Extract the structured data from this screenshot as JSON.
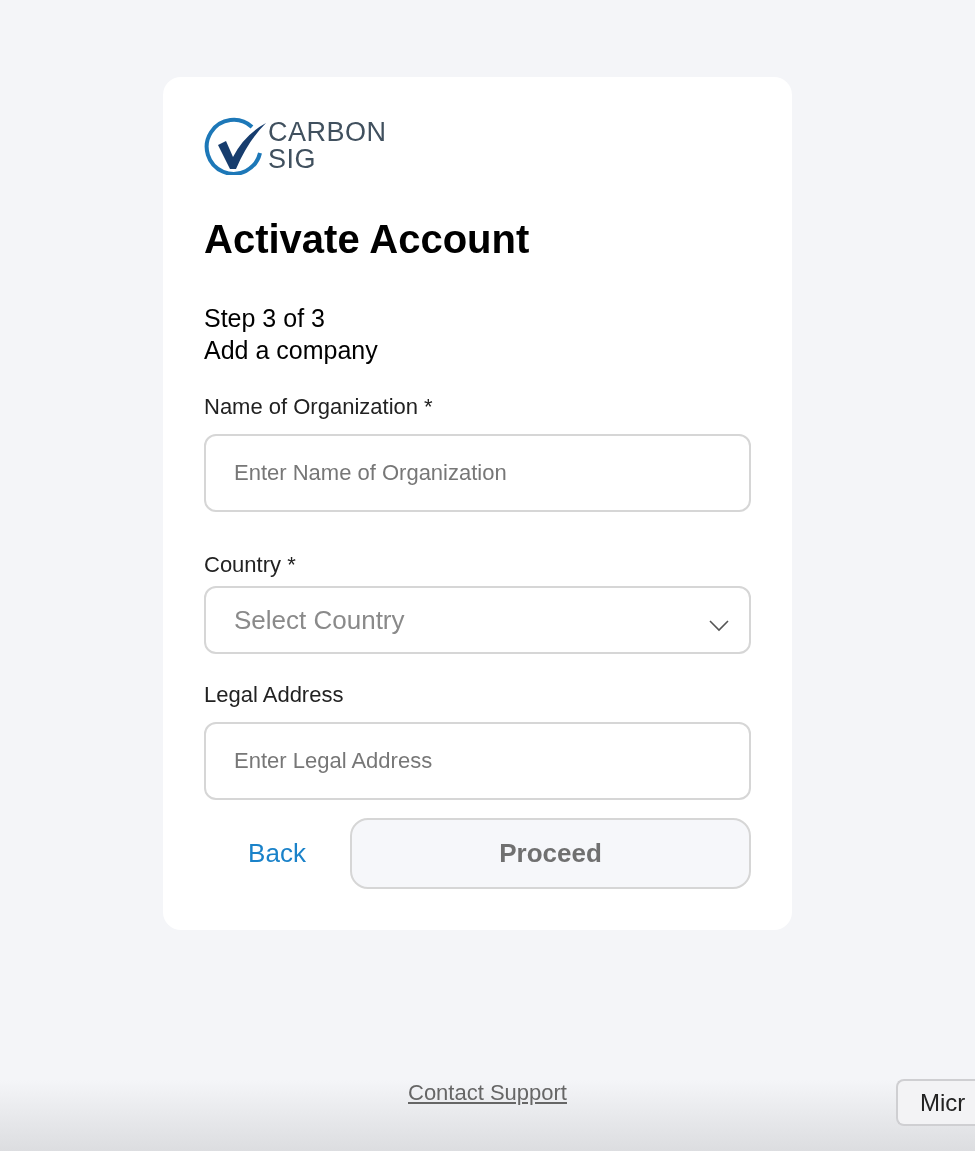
{
  "logo": {
    "line_1": "CARBON",
    "line_2": "SIG"
  },
  "title": "Activate Account",
  "step": "Step 3 of 3",
  "subtitle": "Add a company",
  "fields": [
    {
      "kind": "text",
      "label": "Name of Organization *",
      "placeholder": "Enter Name of Organization"
    },
    {
      "kind": "select",
      "label": "Country *",
      "placeholder": "Select Country"
    },
    {
      "kind": "text",
      "label": "Legal Address",
      "placeholder": "Enter Legal Address"
    }
  ],
  "back_link": "Back",
  "proceed_button": {
    "label": "Proceed",
    "disabled": true
  },
  "footer_link": "Contact Support",
  "corner_button": "Micr"
}
